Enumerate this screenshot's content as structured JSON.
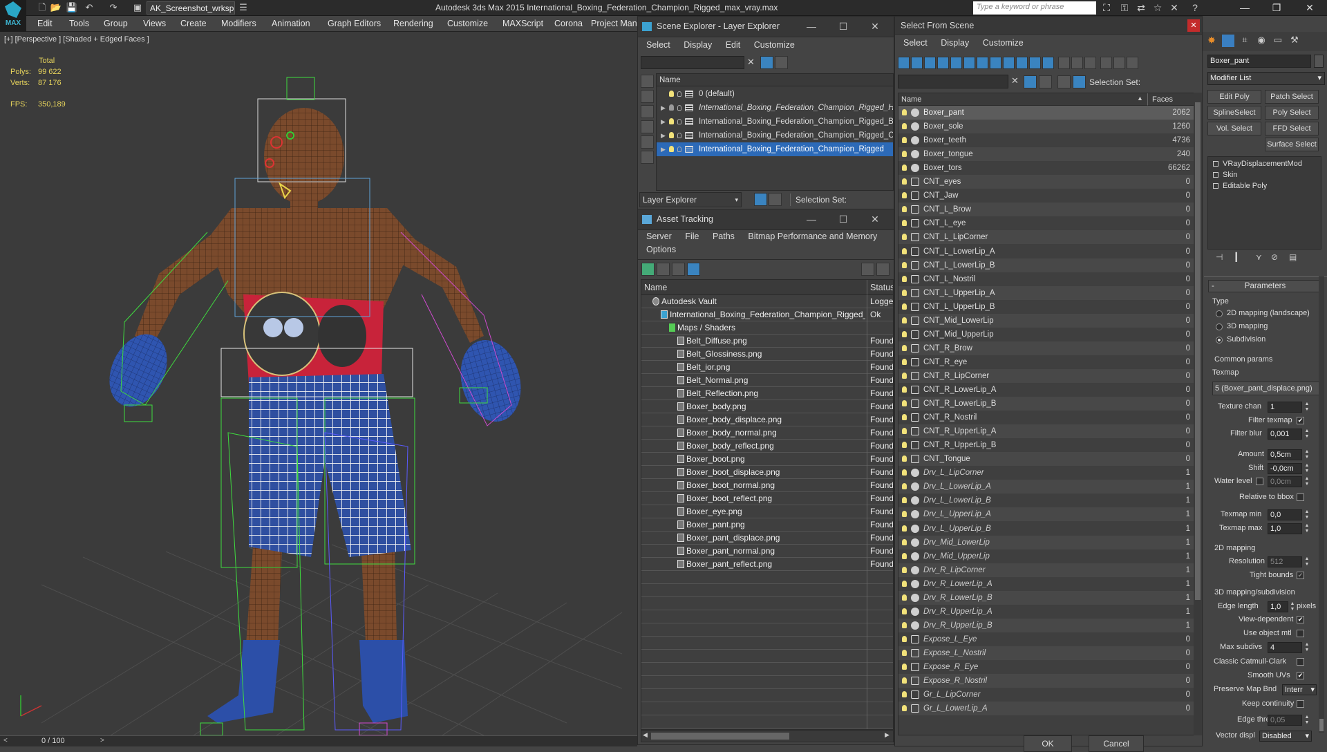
{
  "app": {
    "title": "Autodesk 3ds Max  2015      International_Boxing_Federation_Champion_Rigged_max_vray.max",
    "logo": "MAX",
    "workspace": "AK_Screenshot_wrksp",
    "search_placeholder": "Type a keyword or phrase"
  },
  "menubar": [
    "Edit",
    "Tools",
    "Group",
    "Views",
    "Create",
    "Modifiers",
    "Animation",
    "Graph Editors",
    "Rendering",
    "Customize",
    "MAXScript",
    "Corona",
    "Project Man"
  ],
  "viewport": {
    "label": "[+] [Perspective ] [Shaded + Edged Faces ]",
    "total_label": "Total",
    "polys_label": "Polys:",
    "polys": "99 622",
    "verts_label": "Verts:",
    "verts": "87 176",
    "fps_label": "FPS:",
    "fps": "350,189",
    "timeline": "0 / 100"
  },
  "scene_explorer": {
    "title": "Scene Explorer - Layer Explorer",
    "menu": [
      "Select",
      "Display",
      "Edit",
      "Customize"
    ],
    "column": "Name",
    "rows": [
      {
        "label": "0 (default)",
        "italic": false,
        "selected": false,
        "expand": false
      },
      {
        "label": "International_Boxing_Federation_Champion_Rigged_HELPERS",
        "italic": true,
        "selected": false,
        "expand": true
      },
      {
        "label": "International_Boxing_Federation_Champion_Rigged_BONES",
        "italic": false,
        "selected": false,
        "expand": true
      },
      {
        "label": "International_Boxing_Federation_Champion_Rigged_CONTROLLERS",
        "italic": false,
        "selected": false,
        "expand": true
      },
      {
        "label": "International_Boxing_Federation_Champion_Rigged",
        "italic": false,
        "selected": true,
        "expand": true
      }
    ],
    "footer_dropdown": "Layer Explorer",
    "footer_selection": "Selection Set:"
  },
  "asset_tracking": {
    "title": "Asset Tracking",
    "menu1": [
      "Server",
      "File",
      "Paths",
      "Bitmap Performance and Memory"
    ],
    "menu2": [
      "Options"
    ],
    "col_name": "Name",
    "col_status": "Status",
    "rows": [
      {
        "name": "Autodesk Vault",
        "status": "Logged",
        "indent": 1
      },
      {
        "name": "International_Boxing_Federation_Champion_Rigged_max_vray.max",
        "status": "Ok",
        "indent": 2
      },
      {
        "name": "Maps / Shaders",
        "status": "",
        "indent": 3
      },
      {
        "name": "Belt_Diffuse.png",
        "status": "Found",
        "indent": 4
      },
      {
        "name": "Belt_Glossiness.png",
        "status": "Found",
        "indent": 4
      },
      {
        "name": "Belt_ior.png",
        "status": "Found",
        "indent": 4
      },
      {
        "name": "Belt_Normal.png",
        "status": "Found",
        "indent": 4
      },
      {
        "name": "Belt_Reflection.png",
        "status": "Found",
        "indent": 4
      },
      {
        "name": "Boxer_body.png",
        "status": "Found",
        "indent": 4
      },
      {
        "name": "Boxer_body_displace.png",
        "status": "Found",
        "indent": 4
      },
      {
        "name": "Boxer_body_normal.png",
        "status": "Found",
        "indent": 4
      },
      {
        "name": "Boxer_body_reflect.png",
        "status": "Found",
        "indent": 4
      },
      {
        "name": "Boxer_boot.png",
        "status": "Found",
        "indent": 4
      },
      {
        "name": "Boxer_boot_displace.png",
        "status": "Found",
        "indent": 4
      },
      {
        "name": "Boxer_boot_normal.png",
        "status": "Found",
        "indent": 4
      },
      {
        "name": "Boxer_boot_reflect.png",
        "status": "Found",
        "indent": 4
      },
      {
        "name": "Boxer_eye.png",
        "status": "Found",
        "indent": 4
      },
      {
        "name": "Boxer_pant.png",
        "status": "Found",
        "indent": 4
      },
      {
        "name": "Boxer_pant_displace.png",
        "status": "Found",
        "indent": 4
      },
      {
        "name": "Boxer_pant_normal.png",
        "status": "Found",
        "indent": 4
      },
      {
        "name": "Boxer_pant_reflect.png",
        "status": "Found",
        "indent": 4
      }
    ]
  },
  "select_from_scene": {
    "title": "Select From Scene",
    "menu": [
      "Select",
      "Display",
      "Customize"
    ],
    "selection_set": "Selection Set:",
    "col_name": "Name",
    "col_faces": "Faces",
    "ok": "OK",
    "cancel": "Cancel",
    "rows": [
      {
        "name": "Boxer_pant",
        "faces": "2062",
        "italic": false,
        "helper": false
      },
      {
        "name": "Boxer_sole",
        "faces": "1260",
        "italic": false,
        "helper": false
      },
      {
        "name": "Boxer_teeth",
        "faces": "4736",
        "italic": false,
        "helper": false
      },
      {
        "name": "Boxer_tongue",
        "faces": "240",
        "italic": false,
        "helper": false
      },
      {
        "name": "Boxer_tors",
        "faces": "66262",
        "italic": false,
        "helper": false
      },
      {
        "name": "CNT_eyes",
        "faces": "0",
        "italic": false,
        "helper": true
      },
      {
        "name": "CNT_Jaw",
        "faces": "0",
        "italic": false,
        "helper": true
      },
      {
        "name": "CNT_L_Brow",
        "faces": "0",
        "italic": false,
        "helper": true
      },
      {
        "name": "CNT_L_eye",
        "faces": "0",
        "italic": false,
        "helper": true
      },
      {
        "name": "CNT_L_LipCorner",
        "faces": "0",
        "italic": false,
        "helper": true
      },
      {
        "name": "CNT_L_LowerLip_A",
        "faces": "0",
        "italic": false,
        "helper": true
      },
      {
        "name": "CNT_L_LowerLip_B",
        "faces": "0",
        "italic": false,
        "helper": true
      },
      {
        "name": "CNT_L_Nostril",
        "faces": "0",
        "italic": false,
        "helper": true
      },
      {
        "name": "CNT_L_UpperLip_A",
        "faces": "0",
        "italic": false,
        "helper": true
      },
      {
        "name": "CNT_L_UpperLip_B",
        "faces": "0",
        "italic": false,
        "helper": true
      },
      {
        "name": "CNT_Mid_LowerLip",
        "faces": "0",
        "italic": false,
        "helper": true
      },
      {
        "name": "CNT_Mid_UpperLip",
        "faces": "0",
        "italic": false,
        "helper": true
      },
      {
        "name": "CNT_R_Brow",
        "faces": "0",
        "italic": false,
        "helper": true
      },
      {
        "name": "CNT_R_eye",
        "faces": "0",
        "italic": false,
        "helper": true
      },
      {
        "name": "CNT_R_LipCorner",
        "faces": "0",
        "italic": false,
        "helper": true
      },
      {
        "name": "CNT_R_LowerLip_A",
        "faces": "0",
        "italic": false,
        "helper": true
      },
      {
        "name": "CNT_R_LowerLip_B",
        "faces": "0",
        "italic": false,
        "helper": true
      },
      {
        "name": "CNT_R_Nostril",
        "faces": "0",
        "italic": false,
        "helper": true
      },
      {
        "name": "CNT_R_UpperLip_A",
        "faces": "0",
        "italic": false,
        "helper": true
      },
      {
        "name": "CNT_R_UpperLip_B",
        "faces": "0",
        "italic": false,
        "helper": true
      },
      {
        "name": "CNT_Tongue",
        "faces": "0",
        "italic": false,
        "helper": true
      },
      {
        "name": "Drv_L_LipCorner",
        "faces": "1",
        "italic": true,
        "helper": false
      },
      {
        "name": "Drv_L_LowerLip_A",
        "faces": "1",
        "italic": true,
        "helper": false
      },
      {
        "name": "Drv_L_LowerLip_B",
        "faces": "1",
        "italic": true,
        "helper": false
      },
      {
        "name": "Drv_L_UpperLip_A",
        "faces": "1",
        "italic": true,
        "helper": false
      },
      {
        "name": "Drv_L_UpperLip_B",
        "faces": "1",
        "italic": true,
        "helper": false
      },
      {
        "name": "Drv_Mid_LowerLip",
        "faces": "1",
        "italic": true,
        "helper": false
      },
      {
        "name": "Drv_Mid_UpperLip",
        "faces": "1",
        "italic": true,
        "helper": false
      },
      {
        "name": "Drv_R_LipCorner",
        "faces": "1",
        "italic": true,
        "helper": false
      },
      {
        "name": "Drv_R_LowerLip_A",
        "faces": "1",
        "italic": true,
        "helper": false
      },
      {
        "name": "Drv_R_LowerLip_B",
        "faces": "1",
        "italic": true,
        "helper": false
      },
      {
        "name": "Drv_R_UpperLip_A",
        "faces": "1",
        "italic": true,
        "helper": false
      },
      {
        "name": "Drv_R_UpperLip_B",
        "faces": "1",
        "italic": true,
        "helper": false
      },
      {
        "name": "Expose_L_Eye",
        "faces": "0",
        "italic": true,
        "helper": true
      },
      {
        "name": "Expose_L_Nostril",
        "faces": "0",
        "italic": true,
        "helper": true
      },
      {
        "name": "Expose_R_Eye",
        "faces": "0",
        "italic": true,
        "helper": true
      },
      {
        "name": "Expose_R_Nostril",
        "faces": "0",
        "italic": true,
        "helper": true
      },
      {
        "name": "Gr_L_LipCorner",
        "faces": "0",
        "italic": true,
        "helper": true
      },
      {
        "name": "Gr_L_LowerLip_A",
        "faces": "0",
        "italic": true,
        "helper": true
      }
    ]
  },
  "command_panel": {
    "object_name": "Boxer_pant",
    "modifier_list": "Modifier List",
    "buttons": [
      "Edit Poly",
      "Patch Select",
      "SplineSelect",
      "Poly Select",
      "Vol. Select",
      "FFD Select",
      "Surface Select"
    ],
    "stack": [
      "VRayDisplacementMod",
      "Skin",
      "Editable Poly"
    ],
    "rollout": "Parameters",
    "type_label": "Type",
    "type_options": [
      "2D mapping (landscape)",
      "3D mapping",
      "Subdivision"
    ],
    "common_params": "Common params",
    "texmap_label": "Texmap",
    "texmap_value": "5 (Boxer_pant_displace.png)",
    "texture_chan_label": "Texture chan",
    "texture_chan": "1",
    "filter_texmap_label": "Filter texmap",
    "filter_blur_label": "Filter blur",
    "filter_blur": "0,001",
    "amount_label": "Amount",
    "amount": "0,5cm",
    "shift_label": "Shift",
    "shift": "-0,0cm",
    "water_level_label": "Water level",
    "water_level": "0,0cm",
    "relative_bbox_label": "Relative to bbox",
    "texmap_min_label": "Texmap min",
    "texmap_min": "0,0",
    "texmap_max_label": "Texmap max",
    "texmap_max": "1,0",
    "mapping2d_label": "2D mapping",
    "resolution_label": "Resolution",
    "resolution": "512",
    "tight_bounds_label": "Tight bounds",
    "mapping3d_label": "3D mapping/subdivision",
    "edge_length_label": "Edge length",
    "edge_length": "1,0",
    "pixels_label": "pixels",
    "view_dependent_label": "View-dependent",
    "use_object_mtl_label": "Use object mtl",
    "max_subdivs_label": "Max subdivs",
    "max_subdivs": "4",
    "classic_catmull_label": "Classic Catmull-Clark",
    "smooth_uvs_label": "Smooth UVs",
    "preserve_map_label": "Preserve Map Bnd",
    "preserve_map": "Interr",
    "keep_continuity_label": "Keep continuity",
    "edge_thresh_label": "Edge thresh",
    "edge_thresh": "0,05",
    "vector_displ_label": "Vector displ",
    "vector_displ": "Disabled"
  },
  "colors": {
    "accent": "#2c6ab8",
    "background": "#444444",
    "dark": "#2b2b2b"
  }
}
